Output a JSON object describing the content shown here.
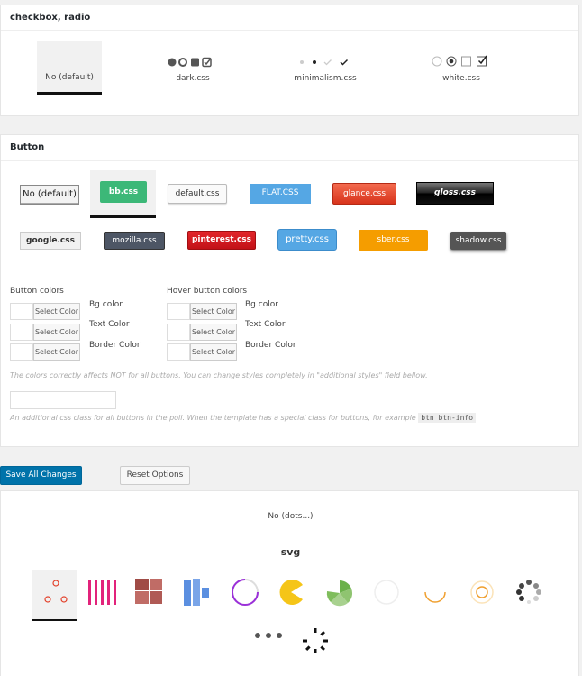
{
  "checkbox_section": {
    "title": "checkbox, radio",
    "options": [
      {
        "label": "No (default)",
        "selected": true
      },
      {
        "label": "dark.css"
      },
      {
        "label": "minimalism.css"
      },
      {
        "label": "white.css"
      }
    ]
  },
  "button_section": {
    "title": "Button",
    "row1": [
      {
        "label": "No (default)"
      },
      {
        "label": "bb.css",
        "selected": true
      },
      {
        "label": "default.css"
      },
      {
        "label": "FLAT.CSS"
      },
      {
        "label": "glance.css"
      },
      {
        "label": "gloss.css"
      }
    ],
    "row2": [
      {
        "label": "google.css"
      },
      {
        "label": "mozilla.css"
      },
      {
        "label": "pinterest.css"
      },
      {
        "label": "pretty.css"
      },
      {
        "label": "sber.css"
      },
      {
        "label": "shadow.css"
      }
    ],
    "button_colors_title": "Button colors",
    "hover_colors_title": "Hover button colors",
    "select_color_label": "Select Color",
    "color_labels": [
      "Bg color",
      "Text Color",
      "Border Color"
    ],
    "colors_hint": "The colors correctly affects NOT for all buttons. You can change styles completely in \"additional styles\" field bellow.",
    "css_class_value": "",
    "css_hint": "An additional css class for all buttons in the poll. When the template has a special class for buttons, for example",
    "css_hint_code": "btn btn-info"
  },
  "actions": {
    "save_label": "Save All Changes",
    "reset_label": "Reset Options"
  },
  "loader_section": {
    "no_dots_label": "No (dots...)",
    "svg_title": "svg"
  }
}
